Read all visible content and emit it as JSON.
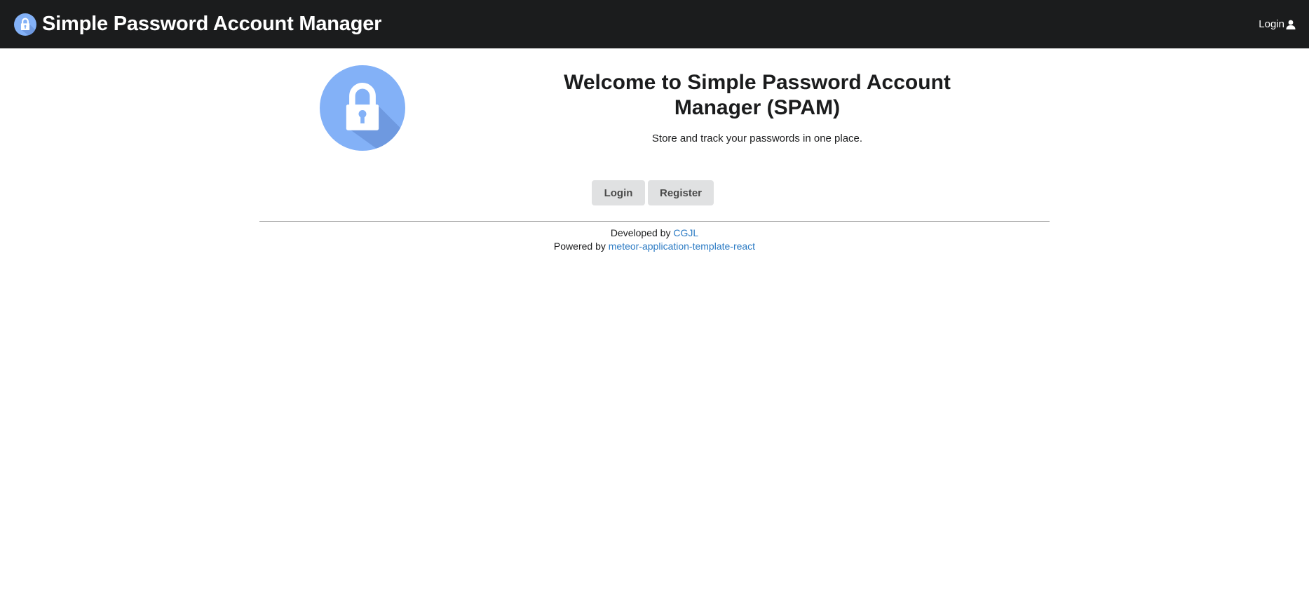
{
  "navbar": {
    "title": "Simple Password Account Manager",
    "login_label": "Login",
    "logo_icon": "lock-icon",
    "user_icon": "user-icon"
  },
  "hero": {
    "title": "Welcome to Simple Password Account Manager (SPAM)",
    "subtitle": "Store and track your passwords in one place.",
    "logo_icon": "lock-icon"
  },
  "buttons": {
    "login_label": "Login",
    "register_label": "Register"
  },
  "footer": {
    "developed_prefix": "Developed by",
    "developer_link": "CGJL",
    "powered_prefix": "Powered by",
    "powered_link": "meteor-application-template-react"
  },
  "colors": {
    "navbar_bg": "#1b1c1d",
    "logo_circle": "#83b1f7",
    "logo_shadow": "#6e99e0",
    "link": "#2c7bc4",
    "button_bg": "#e0e1e2"
  }
}
